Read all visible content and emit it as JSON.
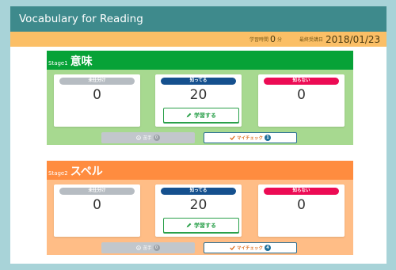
{
  "app": {
    "title": "Vocabulary for Reading"
  },
  "info": {
    "study_time_label": "学習時間",
    "study_time_value": "0",
    "study_time_unit": "分",
    "last_date_label": "最終受講日",
    "last_date_value": "2018/01/23"
  },
  "stages": [
    {
      "num": "Stage1",
      "name": "意味",
      "cards": [
        {
          "label": "未仕分け",
          "count": "0"
        },
        {
          "label": "知ってる",
          "count": "20"
        },
        {
          "label": "知らない",
          "count": "0"
        }
      ],
      "study_label": "学習する",
      "weak_label": "苦手",
      "weak_count": "0",
      "check_label": "マイチェック",
      "check_count": "1"
    },
    {
      "num": "Stage2",
      "name": "スペル",
      "cards": [
        {
          "label": "未仕分け",
          "count": "0"
        },
        {
          "label": "知ってる",
          "count": "20"
        },
        {
          "label": "知らない",
          "count": "0"
        }
      ],
      "study_label": "学習する",
      "weak_label": "苦手",
      "weak_count": "0",
      "check_label": "マイチェック",
      "check_count": "4"
    }
  ],
  "colors": {
    "stage1_header": "#07a237",
    "stage1_body": "#a7d990",
    "stage2_header": "#ff8c3f",
    "stage2_body": "#ffbd86",
    "unsorted_badge": "#b6bcc2",
    "know_badge": "#15508e",
    "dontknow_badge": "#ec0b54"
  },
  "icons": {
    "study": "pencil-icon",
    "weak": "weak-icon",
    "check": "checkmark-icon"
  }
}
